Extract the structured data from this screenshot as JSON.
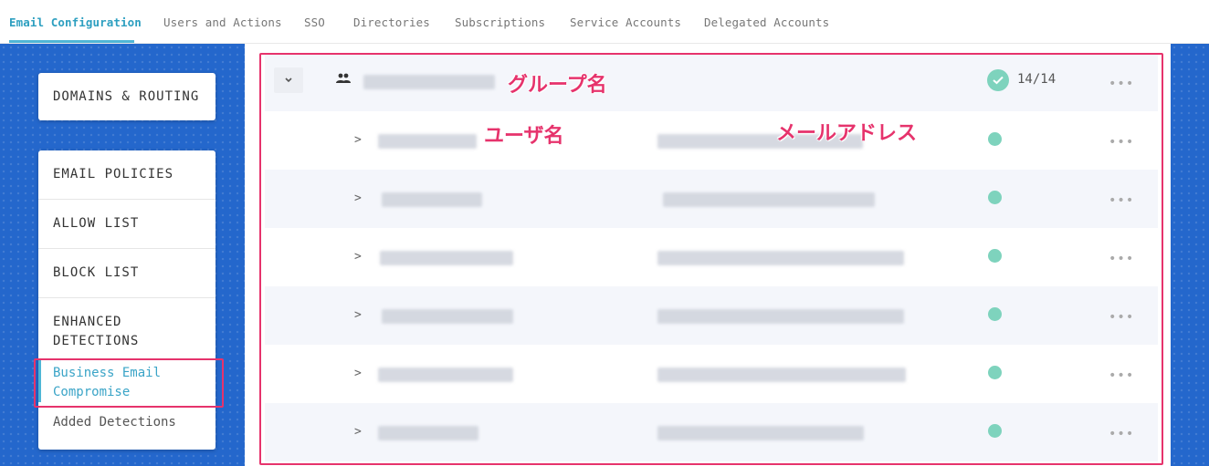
{
  "tabs": [
    {
      "label": "Email Configuration",
      "active": true
    },
    {
      "label": "Users and Actions"
    },
    {
      "label": "SSO"
    },
    {
      "label": "Directories"
    },
    {
      "label": "Subscriptions"
    },
    {
      "label": "Service Accounts"
    },
    {
      "label": "Delegated Accounts"
    }
  ],
  "sidebar": {
    "domains_routing": "DOMAINS & ROUTING",
    "email_policies": "EMAIL POLICIES",
    "allow_list": "ALLOW LIST",
    "block_list": "BLOCK LIST",
    "enhanced_detections": "ENHANCED DETECTIONS",
    "business_email_compromise": "Business Email Compromise",
    "added_detections": "Added Detections"
  },
  "group": {
    "count": "14/14"
  },
  "annotations": {
    "group_name": "グループ名",
    "user_name": "ユーザ名",
    "email_address": "メールアドレス"
  },
  "colors": {
    "accent": "#4fb6d6",
    "brand_blue": "#2467cc",
    "status_green": "#7ed3bd",
    "annotation_red": "#e6336c"
  }
}
